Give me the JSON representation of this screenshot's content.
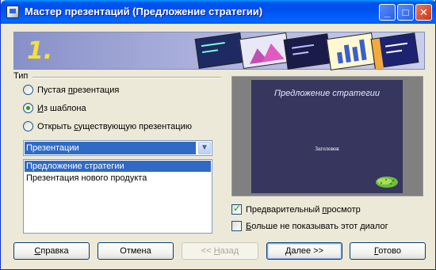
{
  "window": {
    "title": "Мастер презентаций (Предложение стратегии)",
    "controls": [
      "minimize",
      "maximize",
      "close"
    ]
  },
  "banner": {
    "step": "1."
  },
  "type_section": {
    "label": "Тип",
    "options": [
      {
        "label": "Пустая презентация",
        "selected": false
      },
      {
        "label": "Из шаблона",
        "selected": true
      },
      {
        "label": "Открыть существующую презентацию",
        "selected": false
      }
    ],
    "category_select": {
      "value": "Презентации"
    },
    "templates": [
      {
        "label": "Предложение стратегии",
        "selected": true
      },
      {
        "label": "Презентация нового продукта",
        "selected": false
      }
    ]
  },
  "preview": {
    "slide_title": "Предложение стратегии",
    "slide_subtitle": "Заголовок"
  },
  "options": {
    "preview_label": "Предварительный просмотр",
    "preview_checked": true,
    "dont_show_label": "Больше не показывать этот диалог",
    "dont_show_checked": false
  },
  "buttons": {
    "help": "Справка",
    "cancel": "Отмена",
    "back": "<< Назад",
    "next": "Далее >>",
    "finish": "Готово"
  },
  "colors": {
    "titlebar": "#0053ee",
    "selection": "#316ac5",
    "slide_bg": "#36365f",
    "step_number": "#f4e03a"
  }
}
